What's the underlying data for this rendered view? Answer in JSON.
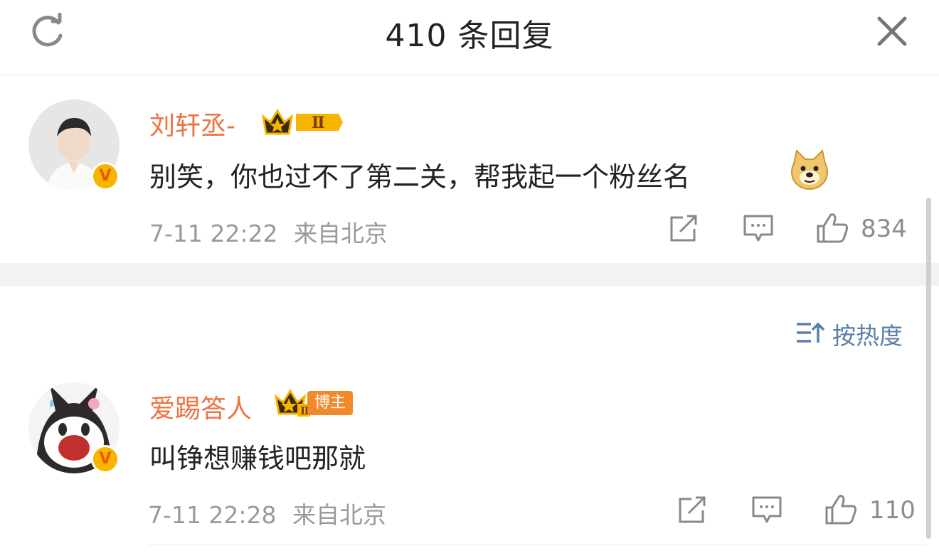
{
  "header": {
    "title": "410 条回复"
  },
  "comments": [
    {
      "username": "刘轩丞-",
      "level_badge": "Ⅱ",
      "text": "别笑，你也过不了第二关，帮我起一个粉丝名",
      "emoji": "doge-emoji",
      "date": "7-11 22:22",
      "location": "来自北京",
      "likes": "834"
    },
    {
      "username": "爱踢答人",
      "level_badge": "Ⅱ",
      "role_badge": "博主",
      "text": "叫铮想赚钱吧那就",
      "date": "7-11 22:28",
      "location": "来自北京",
      "likes": "110"
    }
  ],
  "sort": {
    "label": "按热度"
  },
  "colors": {
    "username": "#eb7340",
    "link": "#5b7fa8",
    "meta": "#9a9a9a",
    "badge_gold": "#f7b500"
  }
}
